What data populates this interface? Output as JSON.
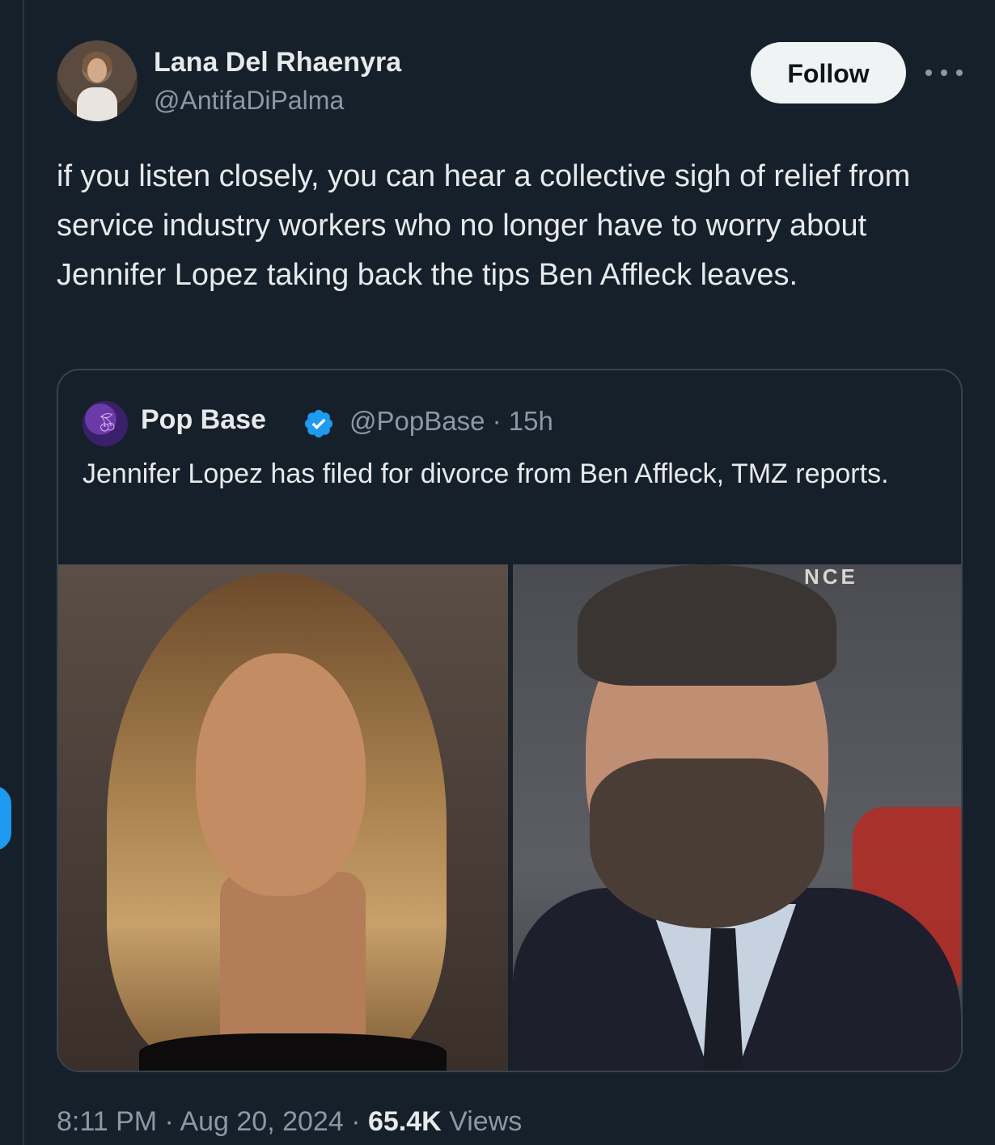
{
  "author": {
    "display_name": "Lana Del Rhaenyra",
    "handle": "@AntifaDiPalma",
    "avatar_icon": "user-photo"
  },
  "actions": {
    "follow_label": "Follow",
    "more_icon": "more-horizontal-icon"
  },
  "tweet": {
    "text": "if you listen closely, you can hear a collective sigh of relief from service industry workers who no longer have to worry about Jennifer Lopez taking back the tips Ben Affleck leaves."
  },
  "quoted_tweet": {
    "display_name": "Pop Base",
    "verified_icon": "verified-badge-icon",
    "verified_color": "#1d9bf0",
    "handle_time": "@PopBase · 15h",
    "text": "Jennifer Lopez has filed for divorce from Ben Affleck, TMZ reports.",
    "photos": [
      "jennifer-lopez-photo",
      "ben-affleck-photo"
    ],
    "photo_sign_text": "NCE"
  },
  "meta": {
    "time": "8:11 PM",
    "separator": " · ",
    "date": "Aug 20, 2024",
    "views_count": "65.4K",
    "views_label": "Views"
  },
  "colors": {
    "background": "#16202b",
    "text_primary": "#e7e9ea",
    "text_secondary": "#8b98a5",
    "border": "#38444d",
    "accent": "#1d9bf0"
  }
}
